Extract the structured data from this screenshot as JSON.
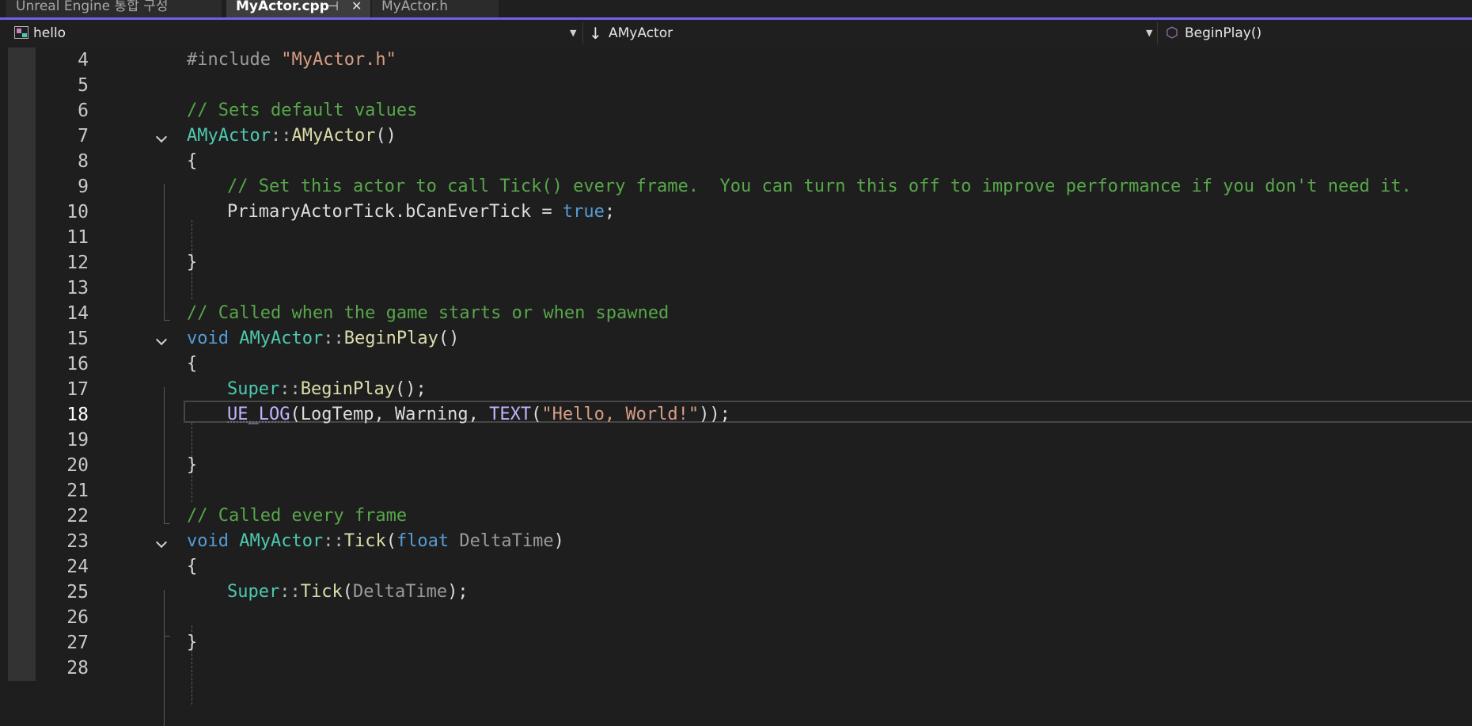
{
  "colors": {
    "accent": "#7160e8",
    "comment": "#57a64a",
    "string": "#d69d85",
    "keyword": "#569cd6",
    "type": "#4ec9b0",
    "function": "#dcdcaa",
    "macro": "#beb7ff"
  },
  "tabs": [
    {
      "label": "Unreal Engine 통합 구성",
      "active": false
    },
    {
      "label": "MyActor.cpp",
      "active": true,
      "pin_icon": "⊣",
      "close_icon": "✕"
    },
    {
      "label": "MyActor.h",
      "active": false
    }
  ],
  "navbar": {
    "project": {
      "label": "hello",
      "icon": "project-icon"
    },
    "scope": {
      "label": "AMyActor",
      "icon": "arrow-down-icon"
    },
    "member": {
      "label": "BeginPlay()",
      "icon": "cube-icon"
    },
    "dropdown_glyph": "▼",
    "down_arrow_glyph": "↓",
    "cube_glyph": "⬡"
  },
  "editor": {
    "current_line": "18",
    "line_numbers": [
      "4",
      "5",
      "6",
      "7",
      "8",
      "9",
      "10",
      "11",
      "12",
      "13",
      "14",
      "15",
      "16",
      "17",
      "18",
      "19",
      "20",
      "21",
      "22",
      "23",
      "24",
      "25",
      "26",
      "27",
      "28"
    ],
    "code": {
      "l4_directive": "#include ",
      "l4_file": "\"MyActor.h\"",
      "l6": "// Sets default values",
      "l7_class": "AMyActor",
      "l7_sep": "::",
      "l7_fn": "AMyActor",
      "l7_paren": "()",
      "brace_open": "{",
      "brace_close": "}",
      "l9": "// Set this actor to call Tick() every frame.  You can turn this off to improve performance if you don't need it.",
      "l10_a": "PrimaryActorTick.bCanEverTick = ",
      "l10_kw": "true",
      "l10_end": ";",
      "l14": "// Called when the game starts or when spawned",
      "l15_void": "void ",
      "l15_class": "AMyActor",
      "l15_sep": "::",
      "l15_fn": "BeginPlay",
      "l15_paren": "()",
      "l17_super": "Super",
      "l17_sep": "::",
      "l17_fn": "BeginPlay",
      "l17_end": "();",
      "l18_macro": "UE_LOG",
      "l18_args": "(LogTemp, Warning, ",
      "l18_text": "TEXT",
      "l18_p": "(",
      "l18_str": "\"Hello, World!\"",
      "l18_end": "));",
      "l22": "// Called every frame",
      "l23_void": "void ",
      "l23_class": "AMyActor",
      "l23_sep": "::",
      "l23_fn": "Tick",
      "l23_p1": "(",
      "l23_float": "float ",
      "l23_param": "DeltaTime",
      "l23_p2": ")",
      "l25_super": "Super",
      "l25_sep": "::",
      "l25_fn": "Tick",
      "l25_p1": "(",
      "l25_param": "DeltaTime",
      "l25_end": ");"
    }
  }
}
